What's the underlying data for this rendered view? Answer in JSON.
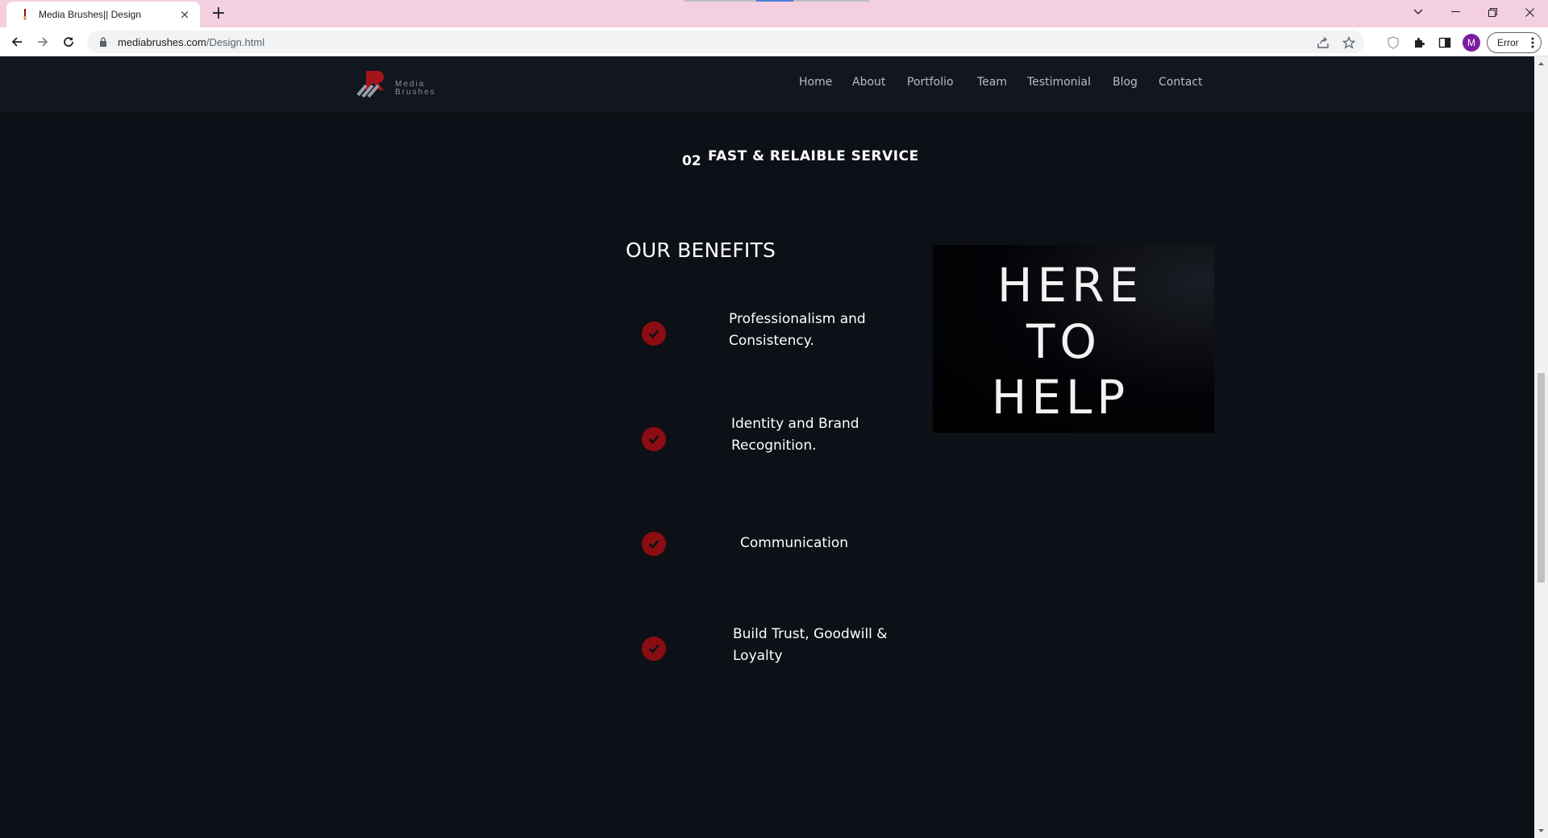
{
  "browser": {
    "tab_title": "Media Brushes|| Design",
    "tab_close": "×",
    "new_tab": "+",
    "url_host": "mediabrushes.com",
    "url_path": "/Design.html",
    "profile_initial": "M",
    "error_label": "Error"
  },
  "site": {
    "logo_text_line1": "Media",
    "logo_text_line2": "Brushes",
    "nav": [
      "Home",
      "About",
      "Portfolio",
      "Team",
      "Testimonial",
      "Blog",
      "Contact"
    ]
  },
  "service": {
    "number": "02",
    "title": "FAST & RELAIBLE SERVICE"
  },
  "benefits": {
    "title": "OUR BENEFITS",
    "items": [
      {
        "line1": "Professionalism and",
        "line2": "Consistency."
      },
      {
        "line1": "Identity and Brand",
        "line2": "Recognition."
      },
      {
        "line1": "Communication",
        "line2": ""
      },
      {
        "line1": "Build Trust, Goodwill &",
        "line2": "Loyalty"
      }
    ]
  },
  "image": {
    "lines": [
      "HERE",
      "TO",
      "HELP"
    ]
  },
  "colors": {
    "accent_red": "#8b0d12",
    "page_bg": "#0d1017",
    "header_bg": "#12161e",
    "tabbar_bg": "#f3cfe0"
  }
}
